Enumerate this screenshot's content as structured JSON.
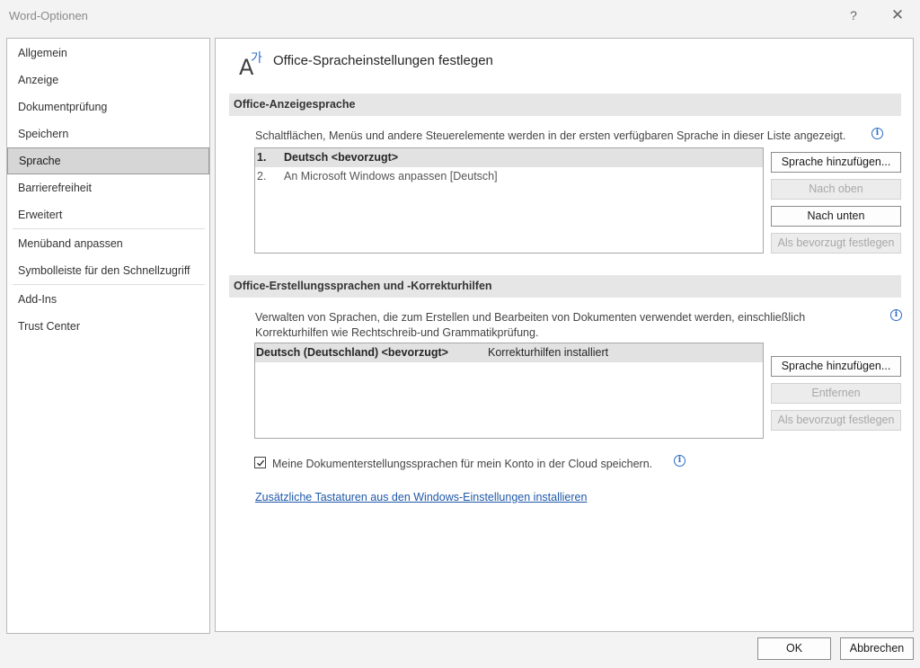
{
  "window": {
    "title": "Word-Optionen",
    "help_label": "?",
    "close_label": "✕"
  },
  "nav": {
    "items": [
      {
        "label": "Allgemein"
      },
      {
        "label": "Anzeige"
      },
      {
        "label": "Dokumentprüfung"
      },
      {
        "label": "Speichern"
      },
      {
        "label": "Sprache",
        "selected": true
      },
      {
        "label": "Barrierefreiheit"
      },
      {
        "label": "Erweitert"
      },
      {
        "label": "Menüband anpassen"
      },
      {
        "label": "Symbolleiste für den Schnellzugriff"
      },
      {
        "label": "Add-Ins"
      },
      {
        "label": "Trust Center"
      }
    ]
  },
  "header": {
    "title": "Office-Spracheinstellungen festlegen",
    "icon": "language-icon"
  },
  "display_language": {
    "heading": "Office-Anzeigesprache",
    "description": "Schaltflächen, Menüs und andere Steuerelemente werden in der ersten verfügbaren Sprache in dieser Liste angezeigt.",
    "list": [
      {
        "num": "1.",
        "text": "Deutsch <bevorzugt>",
        "selected": true
      },
      {
        "num": "2.",
        "text": "An Microsoft Windows anpassen [Deutsch]",
        "selected": false
      }
    ],
    "buttons": {
      "add": "Sprache hinzufügen...",
      "up": "Nach oben",
      "down": "Nach unten",
      "preferred": "Als bevorzugt festlegen"
    }
  },
  "authoring_languages": {
    "heading": "Office-Erstellungssprachen und -Korrekturhilfen",
    "description_line1": "Verwalten von Sprachen, die zum Erstellen und Bearbeiten von Dokumenten verwendet werden, einschließlich",
    "description_line2": "Korrekturhilfen wie Rechtschreib-und Grammatikprüfung.",
    "list": [
      {
        "language": "Deutsch (Deutschland) <bevorzugt>",
        "status": "Korrekturhilfen installiert"
      }
    ],
    "buttons": {
      "add": "Sprache hinzufügen...",
      "remove": "Entfernen",
      "preferred": "Als bevorzugt festlegen"
    },
    "cloud_checkbox": {
      "label": "Meine Dokumenterstellungssprachen für mein Konto in der Cloud speichern.",
      "checked": true
    },
    "keyboards_link": "Zusätzliche Tastaturen aus den Windows-Einstellungen installieren"
  },
  "footer": {
    "ok": "OK",
    "cancel": "Abbrechen"
  },
  "colors": {
    "link": "#2058a8",
    "info": "#2b6cc4",
    "selection": "#d6d6d6"
  }
}
